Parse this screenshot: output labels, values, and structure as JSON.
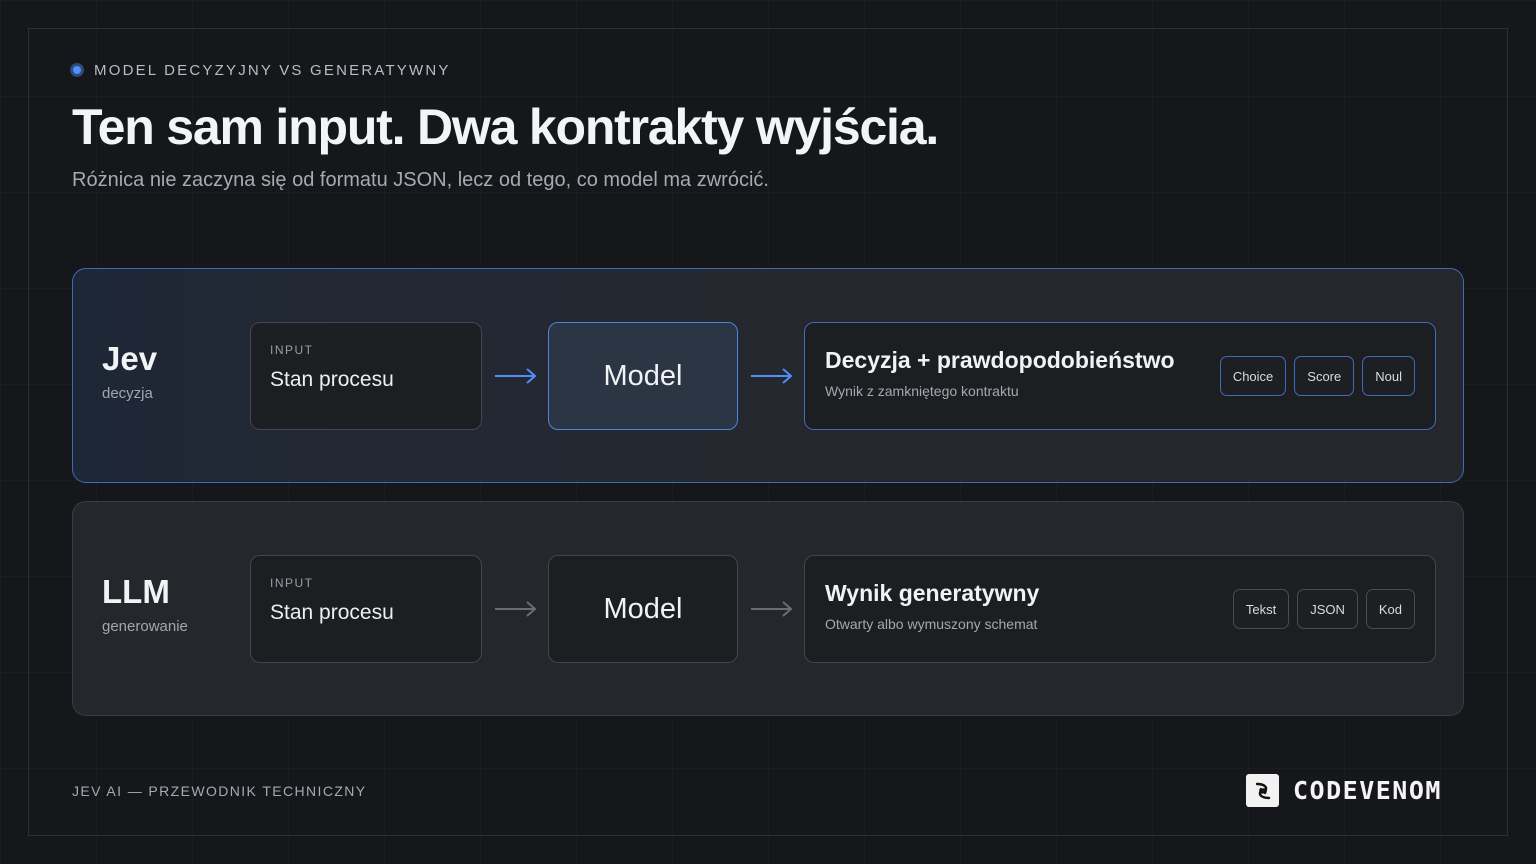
{
  "header": {
    "eyebrow": "MODEL DECYZYJNY VS GENERATYWNY",
    "title": "Ten sam input. Dwa kontrakty wyjścia.",
    "subtitle": "Różnica nie zaczyna się od formatu JSON, lecz od tego, co model ma zwrócić."
  },
  "rows": [
    {
      "name": "Jev",
      "sub": "decyzja",
      "input_caption": "INPUT",
      "input_value": "Stan procesu",
      "model_label": "Model",
      "output_title": "Decyzja + prawdopodobieństwo",
      "output_sub": "Wynik z zamkniętego kontraktu",
      "tags": [
        "Choice",
        "Score",
        "Noul"
      ],
      "accent": "#4f8ff7"
    },
    {
      "name": "LLM",
      "sub": "generowanie",
      "input_caption": "INPUT",
      "input_value": "Stan procesu",
      "model_label": "Model",
      "output_title": "Wynik generatywny",
      "output_sub": "Otwarty albo wymuszony schemat",
      "tags": [
        "Tekst",
        "JSON",
        "Kod"
      ],
      "accent": "#6b6d74"
    }
  ],
  "footer": {
    "left": "JEV AI — PRZEWODNIK TECHNICZNY",
    "brand": "CODEVENOM",
    "logo_icon": "codevenom-logo-icon"
  }
}
